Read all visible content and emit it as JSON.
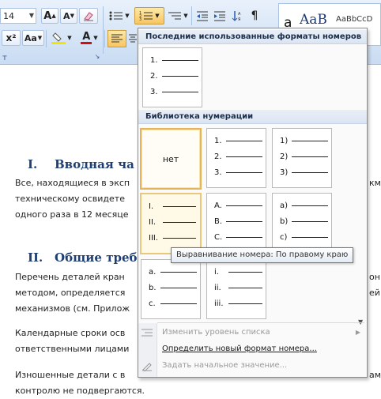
{
  "ribbon": {
    "font_size": "14",
    "grow_font_icon": "A▲",
    "shrink_font_icon": "A▼",
    "superscript_label": "x²",
    "change_case_label": "Aa",
    "font_color_label": "A",
    "group_label": "т",
    "styles": {
      "style1": "a",
      "style2": "AaB",
      "style3": "AaBbCcD"
    },
    "icons": {
      "bullets": "bullet-list-icon",
      "numbering": "numbered-list-icon",
      "multilevel": "multilevel-list-icon",
      "decrease_indent": "decrease-indent-icon",
      "increase_indent": "increase-indent-icon",
      "sort": "sort-icon",
      "show_marks": "pilcrow-icon",
      "clear_format": "clear-format-icon",
      "highlight": "highlighter-icon",
      "align_left": "align-left-icon"
    },
    "colors": {
      "highlight": "#f5e400",
      "font_color": "#d01010"
    }
  },
  "document": {
    "heading1": {
      "num": "I.",
      "text": "Вводная ча"
    },
    "para1": [
      "Все, находящиеся в эксп",
      "техническому освидете",
      "одного раза в 12 месяце"
    ],
    "para1_right": [
      "км",
      "",
      ""
    ],
    "heading2": {
      "num": "II.",
      "text": "Общие треб"
    },
    "para2": [
      "Перечень деталей кран",
      "методом, определяется",
      "механизмов (см. Прилож"
    ],
    "para2_right": [
      "он",
      "ей",
      ""
    ],
    "para3": [
      "Календарные сроки осв",
      "ответственными лицами"
    ],
    "para4": [
      "Изношенные детали с в",
      "контролю не подвергаются."
    ],
    "para4_right": [
      "ам",
      ""
    ]
  },
  "panel": {
    "recent_header": "Последние использованные форматы номеров",
    "library_header": "Библиотека нумерации",
    "recent_tile": [
      "1.",
      "2.",
      "3."
    ],
    "tiles": [
      {
        "type": "none",
        "label": "нет"
      },
      {
        "type": "list",
        "labels": [
          "1.",
          "2.",
          "3."
        ]
      },
      {
        "type": "list",
        "labels": [
          "1)",
          "2)",
          "3)"
        ]
      },
      {
        "type": "list",
        "labels": [
          "I.",
          "II.",
          "III."
        ]
      },
      {
        "type": "list",
        "labels": [
          "A.",
          "B.",
          "C."
        ]
      },
      {
        "type": "list",
        "labels": [
          "a)",
          "b)",
          "c)"
        ]
      },
      {
        "type": "list",
        "labels": [
          "a.",
          "b.",
          "c."
        ]
      },
      {
        "type": "list",
        "labels": [
          "i.",
          "ii.",
          "iii."
        ]
      }
    ],
    "menu": {
      "change_level": "Изменить уровень списка",
      "define_new": "Определить новый формат номера...",
      "set_start": "Задать начальное значение..."
    },
    "tooltip": "Выравнивание номера: По правому краю",
    "colors": {
      "highlight_border": "#e5b45a",
      "header_bg": "#dbe5f2"
    }
  }
}
